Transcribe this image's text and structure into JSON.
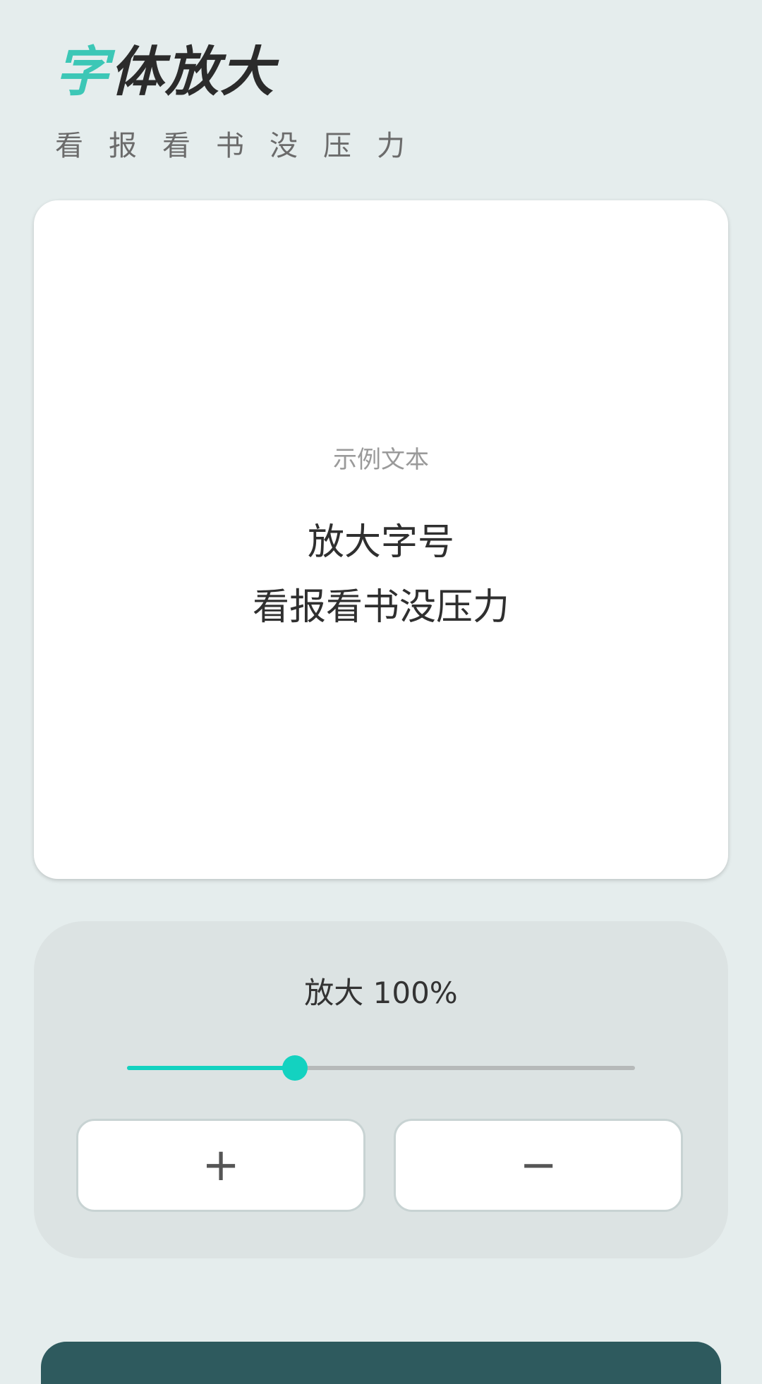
{
  "header": {
    "title_accent": "字",
    "title_rest": "体放大",
    "subtitle": "看报看书没压力"
  },
  "preview": {
    "label": "示例文本",
    "lines": [
      "放大字号",
      "看报看书没压力"
    ]
  },
  "controls": {
    "zoom_label": "放大 100%",
    "slider_value_fraction": 0.33,
    "plus_label": "+",
    "minus_label": "−"
  },
  "colors": {
    "accent": "#13d2c0",
    "title_accent": "#3cc7b6",
    "background": "#e5eded",
    "bottom_bar": "#2e5a5e"
  }
}
